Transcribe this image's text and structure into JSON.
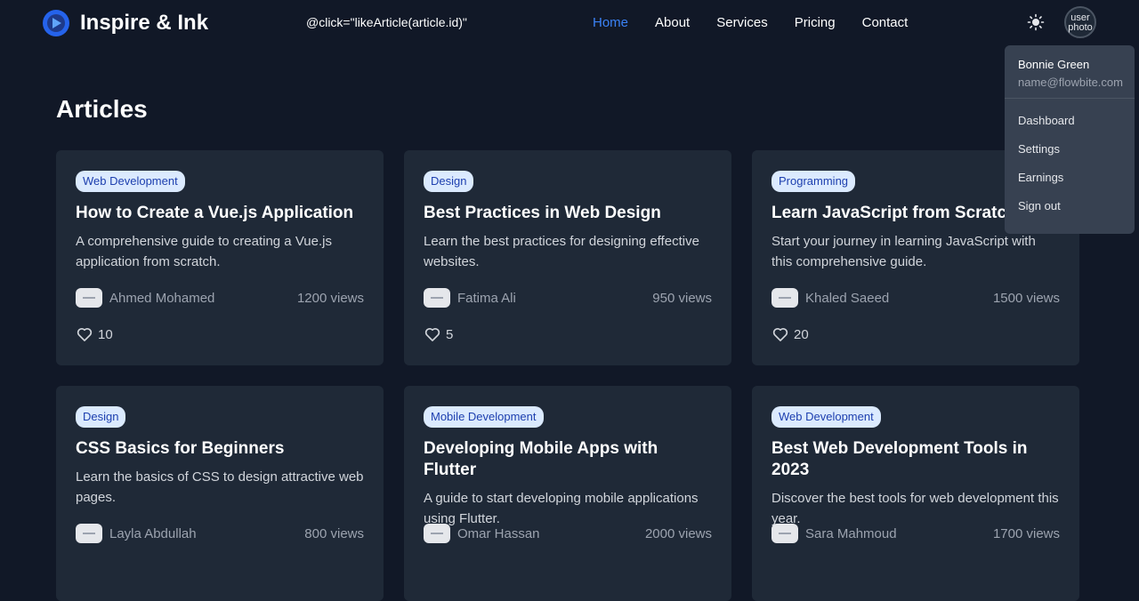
{
  "navbar": {
    "brand": "Inspire & Ink",
    "stray_text": "@click=\"likeArticle(article.id)\"",
    "links": [
      {
        "label": "Home",
        "active": true
      },
      {
        "label": "About",
        "active": false
      },
      {
        "label": "Services",
        "active": false
      },
      {
        "label": "Pricing",
        "active": false
      },
      {
        "label": "Contact",
        "active": false
      }
    ],
    "theme_icon": "sun-icon",
    "avatar_alt": "user photo"
  },
  "page": {
    "title": "Articles"
  },
  "articles": [
    {
      "category": "Web Development",
      "title": "How to Create a Vue.js Application",
      "description": "A comprehensive guide to creating a Vue.js application from scratch.",
      "author": "Ahmed Mohamed",
      "views": "1200 views",
      "likes": "10"
    },
    {
      "category": "Design",
      "title": "Best Practices in Web Design",
      "description": "Learn the best practices for designing effective websites.",
      "author": "Fatima Ali",
      "views": "950 views",
      "likes": "5"
    },
    {
      "category": "Programming",
      "title": "Learn JavaScript from Scratch",
      "description": "Start your journey in learning JavaScript with this comprehensive guide.",
      "author": "Khaled Saeed",
      "views": "1500 views",
      "likes": "20"
    },
    {
      "category": "Design",
      "title": "CSS Basics for Beginners",
      "description": "Learn the basics of CSS to design attractive web pages.",
      "author": "Layla Abdullah",
      "views": "800 views",
      "likes": ""
    },
    {
      "category": "Mobile Development",
      "title": "Developing Mobile Apps with Flutter",
      "description": "A guide to start developing mobile applications using Flutter.",
      "author": "Omar Hassan",
      "views": "2000 views",
      "likes": ""
    },
    {
      "category": "Web Development",
      "title": "Best Web Development Tools in 2023",
      "description": "Discover the best tools for web development this year.",
      "author": "Sara Mahmoud",
      "views": "1700 views",
      "likes": ""
    }
  ],
  "user_menu": {
    "name": "Bonnie Green",
    "email": "name@flowbite.com",
    "items": [
      "Dashboard",
      "Settings",
      "Earnings",
      "Sign out"
    ]
  },
  "colors": {
    "background": "#111827",
    "card": "#1f2937",
    "accent": "#3b82f6",
    "badge_bg": "#dbeafe",
    "badge_text": "#1e40af"
  }
}
